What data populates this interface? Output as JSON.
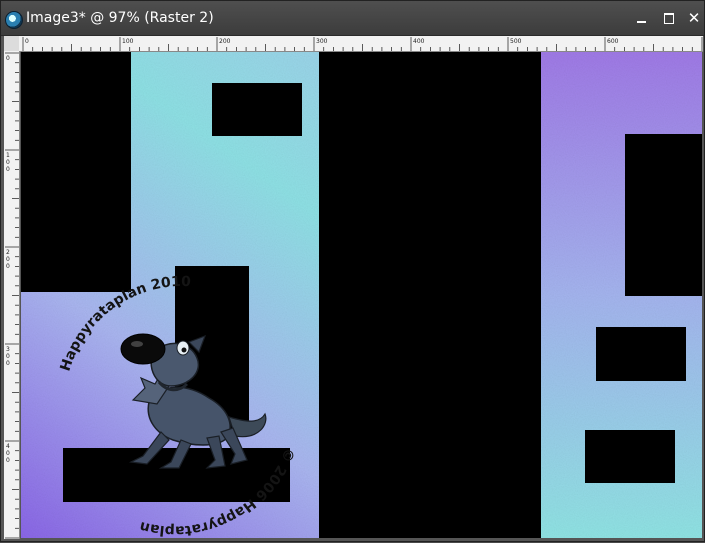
{
  "window": {
    "title": "Image3* @  97% (Raster 2)",
    "icon": "paint-shop-pro-icon",
    "buttons": {
      "minimize": "",
      "maximize": "",
      "close": "✕"
    }
  },
  "rulers": {
    "horizontal_labels": [
      "0",
      "100",
      "200",
      "300",
      "400",
      "500",
      "600"
    ],
    "vertical_labels": [
      "0",
      "100",
      "200",
      "300",
      "400"
    ]
  },
  "canvas": {
    "gradient_colors": [
      "#9fe4ea",
      "#7fd8e0",
      "#b1b2f0",
      "#8a66e6"
    ],
    "background_black": "#000000",
    "watermark": {
      "top_text": "Happyrataplan    2010",
      "bottom_text": "©  2006   Happyrataplan"
    },
    "character": "cartoon-dog-figure"
  }
}
